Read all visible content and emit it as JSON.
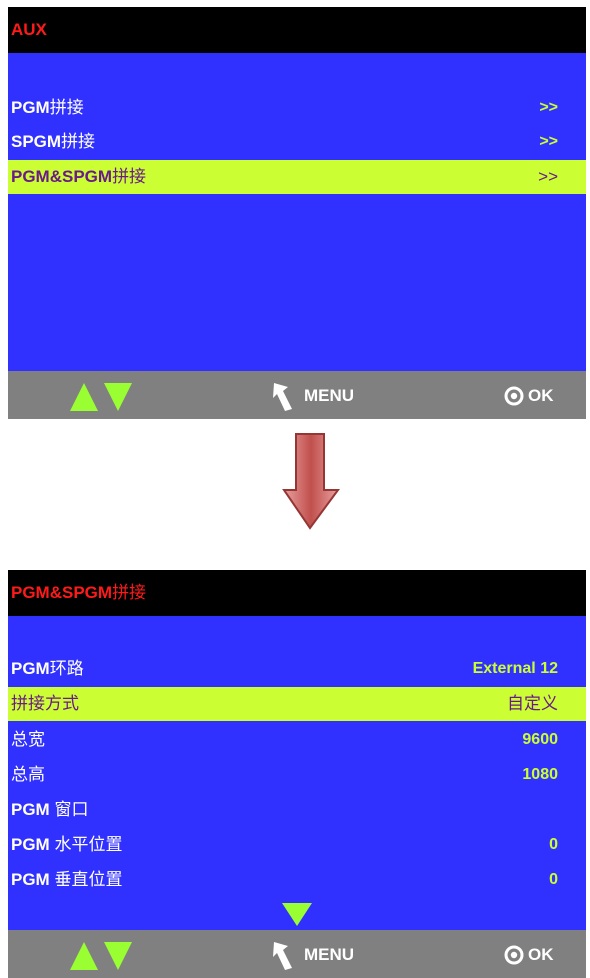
{
  "top_screen": {
    "title": "AUX",
    "items": [
      {
        "label_latin": "PGM",
        "label_cjk": "拼接",
        "value": ">>",
        "selected": false
      },
      {
        "label_latin": "SPGM",
        "label_cjk": "拼接",
        "value": ">>",
        "selected": false
      },
      {
        "label_latin": "PGM&SPGM",
        "label_cjk": "拼接",
        "value": ">>",
        "selected": true
      }
    ],
    "footer": {
      "nav_icon": "up-down-arrows-icon",
      "menu_label": "MENU",
      "ok_label": "OK"
    }
  },
  "bottom_screen": {
    "title_latin": "PGM&SPGM",
    "title_cjk": "拼接",
    "items": [
      {
        "label_latin": "PGM",
        "label_cjk": "环路",
        "value": "External 12",
        "selected": false
      },
      {
        "label_latin": "",
        "label_cjk": "拼接方式",
        "value": "自定义",
        "selected": true
      },
      {
        "label_latin": "",
        "label_cjk": "总宽",
        "value": "9600",
        "selected": false
      },
      {
        "label_latin": "",
        "label_cjk": "总高",
        "value": "1080",
        "selected": false
      },
      {
        "label_latin": "PGM",
        "label_cjk": " 窗口",
        "value": "",
        "selected": false
      },
      {
        "label_latin": "PGM",
        "label_cjk": " 水平位置",
        "value": "0",
        "selected": false
      },
      {
        "label_latin": "PGM",
        "label_cjk": " 垂直位置",
        "value": "0",
        "selected": false
      }
    ],
    "more_indicator": "down-triangle-icon",
    "footer": {
      "nav_icon": "up-down-arrows-icon",
      "menu_label": "MENU",
      "ok_label": "OK"
    }
  },
  "colors": {
    "screen_bg": "#3131ff",
    "title_bar": "#000000",
    "title_text": "#ff1a1a",
    "highlight_row": "#ccff33",
    "value_text": "#ccff33",
    "footer_bg": "#808080",
    "nav_arrow": "#99ff33",
    "transition_arrow": "#c0504d"
  }
}
